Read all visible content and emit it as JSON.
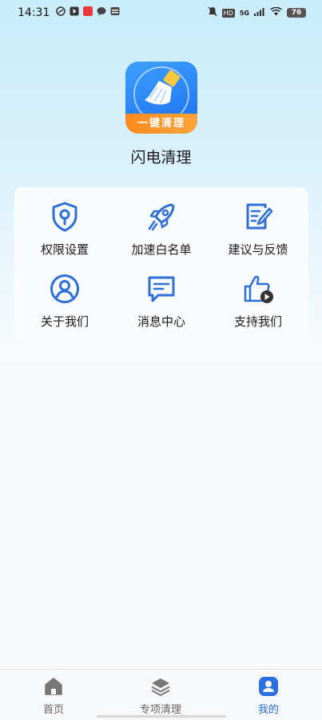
{
  "status_bar": {
    "time": "14:31",
    "network": "5G",
    "hd": "HD",
    "battery": "76"
  },
  "app": {
    "logo_banner": "一键清理",
    "name": "闪电清理"
  },
  "grid": [
    {
      "label": "权限设置",
      "icon": "shield-key-icon"
    },
    {
      "label": "加速白名单",
      "icon": "rocket-icon"
    },
    {
      "label": "建议与反馈",
      "icon": "edit-note-icon"
    },
    {
      "label": "关于我们",
      "icon": "user-circle-icon"
    },
    {
      "label": "消息中心",
      "icon": "chat-message-icon"
    },
    {
      "label": "支持我们",
      "icon": "thumbs-up-video-icon"
    }
  ],
  "bottom_nav": [
    {
      "label": "首页",
      "icon": "home-icon",
      "active": false
    },
    {
      "label": "专项清理",
      "icon": "layers-icon",
      "active": false
    },
    {
      "label": "我的",
      "icon": "profile-icon",
      "active": true
    }
  ],
  "colors": {
    "accent": "#2b6fe0",
    "icon_stroke": "#2e6fd8",
    "logo_orange": "#ff8a1f"
  }
}
